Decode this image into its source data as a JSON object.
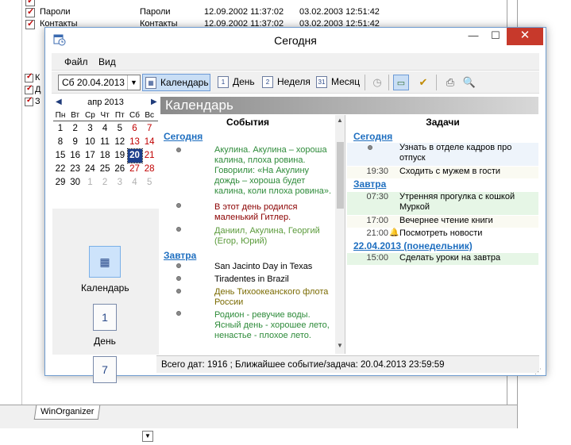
{
  "background": {
    "rows": [
      {
        "name": "Пароли",
        "category": "Пароли",
        "created": "12.09.2002 11:37:02",
        "modified": "03.02.2003 12:51:42"
      },
      {
        "name": "Контакты",
        "category": "Контакты",
        "created": "12.09.2002 11:37:02",
        "modified": "03.02.2003 12:51:42"
      }
    ],
    "side_letters": [
      "К",
      "Д",
      "З"
    ],
    "tab_label": "WinOrganizer"
  },
  "dialog": {
    "title": "Сегодня",
    "window_buttons": {
      "minimize": "—",
      "maximize": "☐",
      "close": "✕"
    },
    "menu": {
      "file": "Файл",
      "view": "Вид"
    },
    "toolbar": {
      "date_value": "Сб 20.04.2013",
      "calendar": "Календарь",
      "day": "День",
      "week": "Неделя",
      "month": "Месяц",
      "day_icon": "1",
      "week_icon": "2",
      "month_icon": "31"
    },
    "mini_calendar": {
      "month_label": "апр 2013",
      "weekdays": [
        "Пн",
        "Вт",
        "Ср",
        "Чт",
        "Пт",
        "Сб",
        "Вс"
      ],
      "weeks": [
        [
          "1",
          "2",
          "3",
          "4",
          "5",
          "6",
          "7"
        ],
        [
          "8",
          "9",
          "10",
          "11",
          "12",
          "13",
          "14"
        ],
        [
          "15",
          "16",
          "17",
          "18",
          "19",
          "20",
          "21"
        ],
        [
          "22",
          "23",
          "24",
          "25",
          "26",
          "27",
          "28"
        ],
        [
          "29",
          "30",
          "1",
          "2",
          "3",
          "4",
          "5"
        ]
      ],
      "selected_day": "20",
      "colors": {
        "weekend": "#c00000",
        "other_month": "#b0b0b0",
        "selected_bg": "#1c3f8c"
      }
    },
    "nav": {
      "calendar_label": "Календарь",
      "day_label": "День",
      "day_icon": "1",
      "week_icon": "7"
    },
    "content_title": "Календарь",
    "events": {
      "header": "События",
      "today_label": "Сегодня",
      "tomorrow_label": "Завтра",
      "today": [
        {
          "text": "Акулина. Акулина – хороша калина, плоха ровина. Говорили: «На Акулину дождь – хороша будет калина, коли плоха ровина».",
          "color": "#2e8b3a"
        },
        {
          "text": "В этот день родился маленький Гитлер.",
          "color": "#8b0000"
        },
        {
          "text": "Даниил, Акулина, Георгий (Егор, Юрий)",
          "color": "#5a9a3a"
        }
      ],
      "tomorrow": [
        {
          "text": "San Jacinto Day in Texas",
          "color": "#000000"
        },
        {
          "text": "Tiradentes in Brazil",
          "color": "#000000"
        },
        {
          "text": "День Тихоокеанского флота России",
          "color": "#7a6a00"
        },
        {
          "text": "Родион - ревучие воды. Ясный день - хорошее лето, ненастье - плохое лето.",
          "color": "#2e8b3a"
        }
      ]
    },
    "tasks": {
      "header": "Задачи",
      "today_label": "Сегодня",
      "tomorrow_label": "Завтра",
      "monday_label": "22.04.2013 (понедельник)",
      "today": [
        {
          "time": "",
          "text": "Узнать в отделе кадров про отпуск",
          "bg": "#eef4fb"
        },
        {
          "time": "19:30",
          "text": "Сходить с мужем в гости",
          "bg": "#fafaf2"
        }
      ],
      "tomorrow": [
        {
          "time": "07:30",
          "text": "Утренняя прогулка с кошкой Муркой",
          "bg": "#e6f6e6"
        },
        {
          "time": "17:00",
          "text": "Вечернее чтение книги",
          "bg": "#fafaf2"
        },
        {
          "time": "21:00",
          "text": "Посмотреть новости",
          "bg": "#ffffff",
          "alarm": "🔔"
        }
      ],
      "monday": [
        {
          "time": "15:00",
          "text": "Сделать уроки на завтра",
          "bg": "#e6f6e6"
        }
      ]
    },
    "status": "Всего дат: 1916 ; Ближайшее событие/задача: 20.04.2013 23:59:59"
  }
}
